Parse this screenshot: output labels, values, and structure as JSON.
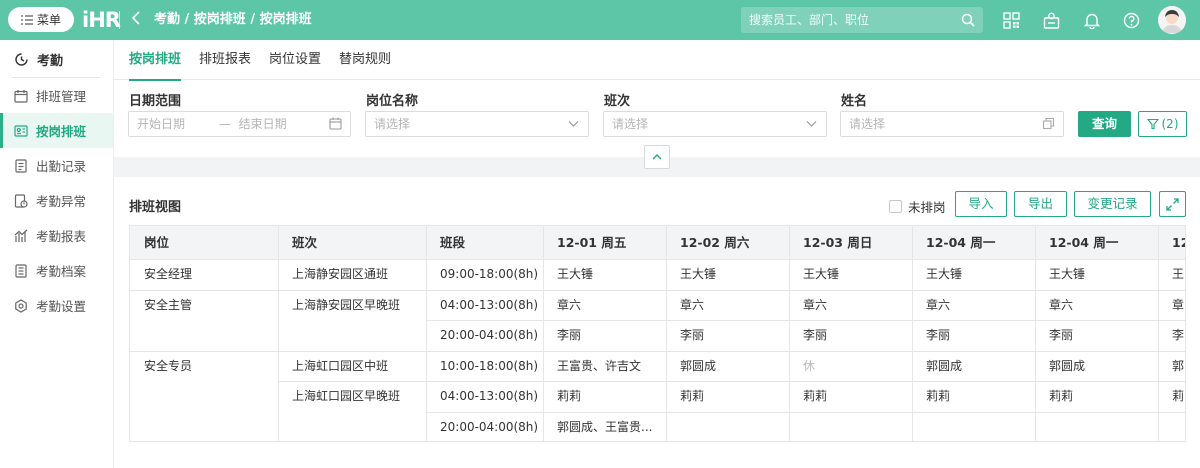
{
  "topbar": {
    "menu_label": "菜单",
    "logo": "iHR",
    "breadcrumb": "考勤 / 按岗排班 / 按岗排班",
    "search_placeholder": "搜索员工、部门、职位",
    "accent": "#5cc6a6"
  },
  "sidebar": {
    "header": "考勤",
    "items": [
      {
        "label": "排班管理",
        "icon": "calendar-icon"
      },
      {
        "label": "按岗排班",
        "icon": "id-card-icon"
      },
      {
        "label": "出勤记录",
        "icon": "record-icon"
      },
      {
        "label": "考勤异常",
        "icon": "warning-doc-icon"
      },
      {
        "label": "考勤报表",
        "icon": "chart-icon"
      },
      {
        "label": "考勤档案",
        "icon": "archive-icon"
      },
      {
        "label": "考勤设置",
        "icon": "gear-icon"
      }
    ],
    "active_index": 1
  },
  "tabs": [
    "按岗排班",
    "排班报表",
    "岗位设置",
    "替岗规则"
  ],
  "filters": {
    "date_label": "日期范围",
    "date_start_placeholder": "开始日期",
    "date_sep": "—",
    "date_end_placeholder": "结束日期",
    "post_label": "岗位名称",
    "post_placeholder": "请选择",
    "shift_label": "班次",
    "shift_placeholder": "请选择",
    "name_label": "姓名",
    "name_placeholder": "请选择",
    "query_button": "查询",
    "filter_button": "(2)"
  },
  "schedule": {
    "title": "排班视图",
    "unscheduled_label": "未排岗",
    "import_button": "导入",
    "export_button": "导出",
    "changelog_button": "变更记录",
    "columns": [
      "岗位",
      "班次",
      "班段",
      "12-01 周五",
      "12-02 周六",
      "12-03 周日",
      "12-04 周一",
      "12-04 周一",
      "12"
    ],
    "groups": [
      {
        "post": "安全经理",
        "shifts": [
          {
            "name": "上海静安园区通班",
            "segments": [
              {
                "time": "09:00-18:00(8h)",
                "days": [
                  "王大锤",
                  "王大锤",
                  "王大锤",
                  "王大锤",
                  "王大锤",
                  "王"
                ]
              }
            ]
          }
        ]
      },
      {
        "post": "安全主管",
        "shifts": [
          {
            "name": "上海静安园区早晚班",
            "segments": [
              {
                "time": "04:00-13:00(8h)",
                "days": [
                  "章六",
                  "章六",
                  "章六",
                  "章六",
                  "章六",
                  "章"
                ]
              },
              {
                "time": "20:00-04:00(8h)",
                "days": [
                  "李丽",
                  "李丽",
                  "李丽",
                  "李丽",
                  "李丽",
                  "李"
                ]
              }
            ]
          }
        ]
      },
      {
        "post": "安全专员",
        "shifts": [
          {
            "name": "上海虹口园区中班",
            "segments": [
              {
                "time": "10:00-18:00(8h)",
                "days": [
                  "王富贵、许吉文",
                  "郭圆成",
                  "休",
                  "郭圆成",
                  "郭圆成",
                  "郭"
                ]
              }
            ]
          },
          {
            "name": "上海虹口园区早晚班",
            "segments": [
              {
                "time": "04:00-13:00(8h)",
                "days": [
                  "莉莉",
                  "莉莉",
                  "莉莉",
                  "莉莉",
                  "莉莉",
                  "莉"
                ]
              },
              {
                "time": "20:00-04:00(8h)",
                "days": [
                  "郭圆成、王富贵...",
                  "",
                  "",
                  "",
                  "",
                  ""
                ]
              }
            ]
          }
        ]
      }
    ],
    "rest_value": "休"
  }
}
